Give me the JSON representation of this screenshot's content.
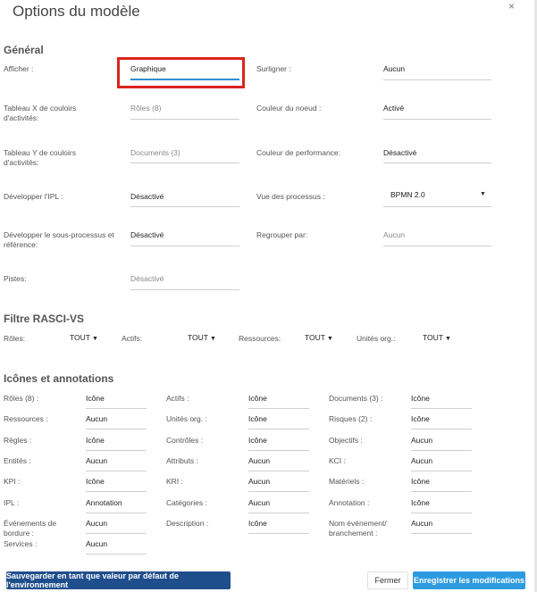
{
  "dialog": {
    "title": "Options du modèle",
    "close": "×"
  },
  "general": {
    "heading": "Général",
    "fields": [
      {
        "label": "Afficher :",
        "value": "Graphique"
      },
      {
        "label": "Surligner :",
        "value": "Aucun"
      },
      {
        "label": "Tableau X de couloirs d'activités:",
        "value": "Rôles (8)"
      },
      {
        "label": "Couleur du noeud :",
        "value": "Activé"
      },
      {
        "label": "Tableau Y de couloirs d'activités:",
        "value": "Documents (3)"
      },
      {
        "label": "Couleur de performance:",
        "value": "Désactivé"
      },
      {
        "label": "Développer l'IPL :",
        "value": "Désactivé"
      },
      {
        "label": "Vue des processus :",
        "value": "BPMN 2.0"
      },
      {
        "label": "Développer le sous-processus et référence:",
        "value": "Désactivé"
      },
      {
        "label": "Regrouper par:",
        "value": "Aucun"
      },
      {
        "label": "Pistes:",
        "value": "Désactivé"
      }
    ]
  },
  "filter": {
    "heading": "Filtre RASCI-VS",
    "items": [
      {
        "label": "Rôles:",
        "value": "TOUT"
      },
      {
        "label": "Actifs:",
        "value": "TOUT"
      },
      {
        "label": "Ressources:",
        "value": "TOUT"
      },
      {
        "label": "Unités org.:",
        "value": "TOUT"
      }
    ]
  },
  "icons": {
    "heading": "Icônes et annotations",
    "rows": [
      [
        {
          "label": "Rôles (8) :",
          "value": "Icône"
        },
        {
          "label": "Actifs :",
          "value": "Icône"
        },
        {
          "label": "Documents (3) :",
          "value": "Icône"
        }
      ],
      [
        {
          "label": "Ressources :",
          "value": "Aucun"
        },
        {
          "label": "Unités org. :",
          "value": "Icône"
        },
        {
          "label": "Risques (2) :",
          "value": "Icône"
        }
      ],
      [
        {
          "label": "Règles :",
          "value": "Icône"
        },
        {
          "label": "Contrôles :",
          "value": "Icône"
        },
        {
          "label": "Objectifs :",
          "value": "Aucun"
        }
      ],
      [
        {
          "label": "Entités :",
          "value": "Aucun"
        },
        {
          "label": "Attributs :",
          "value": "Aucun"
        },
        {
          "label": "KCI :",
          "value": "Aucun"
        }
      ],
      [
        {
          "label": "KPI :",
          "value": "Icône"
        },
        {
          "label": "KRI :",
          "value": "Aucun"
        },
        {
          "label": "Matériels :",
          "value": "Icône"
        }
      ],
      [
        {
          "label": "IPL :",
          "value": "Annotation"
        },
        {
          "label": "Catégories :",
          "value": "Aucun"
        },
        {
          "label": "Annotation :",
          "value": "Icône"
        }
      ],
      [
        {
          "label": "Événements de bordure :",
          "value": "Aucun"
        },
        {
          "label": "Description :",
          "value": "Icône"
        },
        {
          "label": "Nom événement/ branchement :",
          "value": "Aucun"
        }
      ],
      [
        {
          "label": "Services :",
          "value": "Aucun"
        }
      ]
    ]
  },
  "footer": {
    "save_default": "Sauvegarder en tant que valeur par défaut de l'environnement",
    "close": "Fermer",
    "save": "Enregistrer les modifications"
  },
  "colors": {
    "accent": "#2e8fd0",
    "highlight": "#d9241e",
    "primary_dark": "#1f4e8c",
    "primary": "#2e9be0"
  }
}
